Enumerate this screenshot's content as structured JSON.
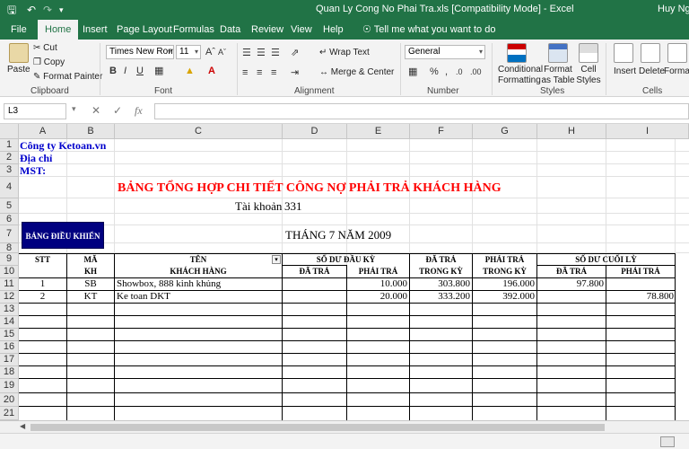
{
  "window": {
    "title": "Quan Ly Cong No Phai Tra.xls [Compatibility Mode] - Excel",
    "user": "Huy Nguy"
  },
  "tabs": [
    "File",
    "Home",
    "Insert",
    "Page Layout",
    "Formulas",
    "Data",
    "Review",
    "View",
    "Help"
  ],
  "tell_me": "Tell me what you want to do",
  "ribbon": {
    "clipboard": {
      "paste": "Paste",
      "cut": "Cut",
      "copy": "Copy",
      "format_painter": "Format Painter",
      "label": "Clipboard"
    },
    "font": {
      "name": "Times New Roma",
      "size": "11",
      "bold": "B",
      "italic": "I",
      "underline": "U",
      "label": "Font"
    },
    "alignment": {
      "wrap": "Wrap Text",
      "merge": "Merge & Center",
      "label": "Alignment"
    },
    "number": {
      "format": "General",
      "label": "Number"
    },
    "styles": {
      "conditional": "Conditional Formatting",
      "format_table": "Format as Table",
      "cell_styles": "Cell Styles",
      "label": "Styles"
    },
    "cells": {
      "insert": "Insert",
      "delete": "Delete",
      "format": "Format",
      "label": "Cells"
    }
  },
  "formula_bar": {
    "name_box": "L3",
    "fx": "fx",
    "value": ""
  },
  "columns": [
    "A",
    "B",
    "C",
    "D",
    "E",
    "F",
    "G",
    "H",
    "I"
  ],
  "rows": [
    "1",
    "2",
    "3",
    "4",
    "5",
    "6",
    "7",
    "8",
    "9",
    "10",
    "11",
    "12",
    "13",
    "14",
    "15",
    "16",
    "17",
    "18",
    "19",
    "20",
    "21"
  ],
  "sheet": {
    "company": "Công ty  Ketoan.vn",
    "address": "Địa chỉ",
    "tax": "MST:",
    "title": "BẢNG TỔNG HỢP CHI TIẾT CÔNG NỢ PHẢI TRẢ KHÁCH HÀNG",
    "account_label": "Tài khoản",
    "account_no": "331",
    "dashboard_button": "BẢNG ĐIỀU KHIỂN",
    "period": "THÁNG 7 NĂM 2009",
    "headers": {
      "stt": "STT",
      "ma1": "MÃ",
      "ma2": "KH",
      "ten1": "TÊN",
      "ten2": "KHÁCH HÀNG",
      "so_du_dau": "SỐ DƯ ĐẦU KỲ",
      "da_tra": "ĐÃ TRẢ",
      "phai_tra": "PHẢI TRẢ",
      "da_tra_trong1": "ĐÃ TRẢ",
      "da_tra_trong2": "TRONG KỲ",
      "phai_tra_trong1": "PHẢI TRẢ",
      "phai_tra_trong2": "TRONG KỲ",
      "so_du_cuoi": "SỐ DƯ CUỐI LỲ",
      "da_tra_cuoi": "ĐÃ TRẢ",
      "phai_tra_cuoi": "PHẢI TRẢ"
    },
    "data_rows": [
      {
        "stt": "1",
        "ma": "SB",
        "ten": "Showbox, 888 kinh khủng",
        "dau_da_tra": "",
        "dau_phai_tra": "10.000",
        "da_tra_trong": "303.800",
        "phai_tra_trong": "196.000",
        "cuoi_da_tra": "97.800",
        "cuoi_phai_tra": ""
      },
      {
        "stt": "2",
        "ma": "KT",
        "ten": "Ke toan DKT",
        "dau_da_tra": "",
        "dau_phai_tra": "20.000",
        "da_tra_trong": "333.200",
        "phai_tra_trong": "392.000",
        "cuoi_da_tra": "",
        "cuoi_phai_tra": "78.800"
      }
    ]
  },
  "colors": {
    "excel_green": "#217346",
    "title_red": "#ff0000",
    "company_blue": "#0000cc",
    "dashboard_navy": "#000080"
  }
}
